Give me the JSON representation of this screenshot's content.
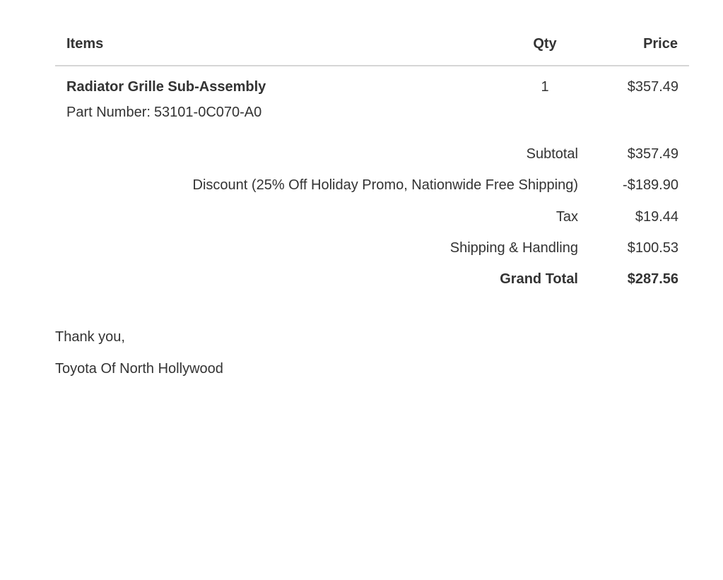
{
  "table": {
    "headers": {
      "items": "Items",
      "qty": "Qty",
      "price": "Price"
    },
    "rows": [
      {
        "name": "Radiator Grille Sub-Assembly",
        "part_label": "Part Number:",
        "part_number": "53101-0C070-A0",
        "qty": "1",
        "price": "$357.49"
      }
    ]
  },
  "summary": {
    "subtotal": {
      "label": "Subtotal",
      "value": "$357.49"
    },
    "discount": {
      "label": "Discount (25% Off Holiday Promo, Nationwide Free Shipping)",
      "value": "-$189.90"
    },
    "tax": {
      "label": "Tax",
      "value": "$19.44"
    },
    "shipping": {
      "label": "Shipping & Handling",
      "value": "$100.53"
    },
    "grand_total": {
      "label": "Grand Total",
      "value": "$287.56"
    }
  },
  "closing": {
    "thanks": "Thank you,",
    "signature": "Toyota Of North Hollywood"
  }
}
